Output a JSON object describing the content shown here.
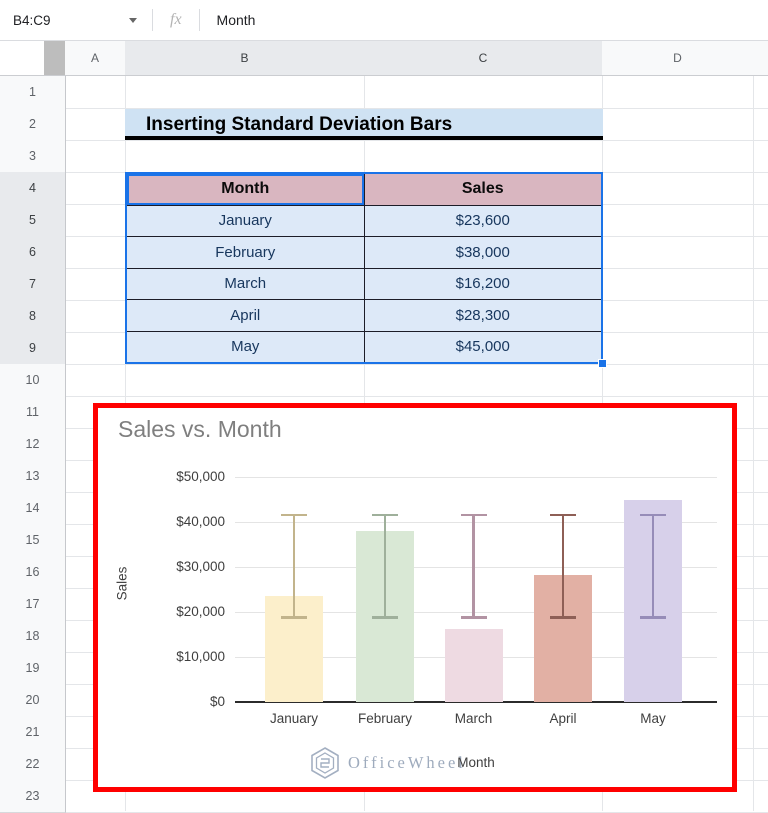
{
  "formula_bar": {
    "name_box_value": "B4:C9",
    "fx_label": "fx",
    "formula_value": "Month"
  },
  "sheet": {
    "column_headers": [
      "A",
      "B",
      "C",
      "D"
    ],
    "selected_columns": [
      "B",
      "C"
    ],
    "row_numbers": [
      1,
      2,
      3,
      4,
      5,
      6,
      7,
      8,
      9,
      10,
      11,
      12,
      13,
      14,
      15,
      16,
      17,
      18,
      19,
      20,
      21,
      22,
      23
    ],
    "selected_rows": [
      4,
      5,
      6,
      7,
      8,
      9
    ]
  },
  "banner": {
    "text": "Inserting Standard Deviation Bars"
  },
  "table": {
    "headers": [
      "Month",
      "Sales"
    ],
    "rows": [
      [
        "January",
        "$23,600"
      ],
      [
        "February",
        "$38,000"
      ],
      [
        "March",
        "$16,200"
      ],
      [
        "April",
        "$28,300"
      ],
      [
        "May",
        "$45,000"
      ]
    ]
  },
  "chart_data": {
    "type": "bar",
    "title": "Sales vs. Month",
    "xlabel": "Month",
    "ylabel": "Sales",
    "categories": [
      "January",
      "February",
      "March",
      "April",
      "May"
    ],
    "values": [
      23600,
      38000,
      16200,
      28300,
      45000
    ],
    "ylim": [
      0,
      50000
    ],
    "ytick_step": 10000,
    "ytick_labels": [
      "$0",
      "$10,000",
      "$20,000",
      "$30,000",
      "$40,000",
      "$50,000"
    ],
    "grid": true,
    "legend": "none",
    "error_bars": {
      "kind": "standard deviation",
      "low": 18785,
      "high": 41655
    },
    "bar_colors": [
      "#fcefcb",
      "#d9e8d5",
      "#eedae2",
      "#e2b0a4",
      "#d7d0ea"
    ],
    "error_bar_colors": [
      "#c2b48c",
      "#9fb09b",
      "#b293a3",
      "#8e5f56",
      "#968cb8"
    ]
  },
  "watermark": {
    "text": "OfficeWheel"
  },
  "colors": {
    "selection_blue": "#1a73e8",
    "chart_outline_red": "#ff0000",
    "banner_bg": "#cfe2f3",
    "table_header_bg": "#d9b6c0",
    "table_row_bg": "#dde9f8",
    "table_border": "#1c1c28",
    "table_text": "#17365d",
    "chart_title_gray": "#7f7f7f",
    "watermark_gray": "#94a2b6"
  }
}
